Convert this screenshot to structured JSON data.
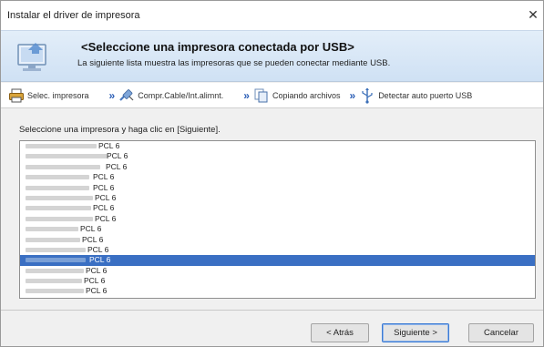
{
  "window": {
    "title": "Instalar el driver de impresora",
    "close_glyph": "✕"
  },
  "banner": {
    "heading": "<Seleccione una impresora conectada por USB>",
    "subheading": "La siguiente lista muestra las impresoras que se pueden conectar mediante USB.",
    "icon": "monitor-icon"
  },
  "steps": [
    {
      "label": "Selec. impresora",
      "icon": "printer-icon"
    },
    {
      "label": "Compr.Cable/Int.alimnt.",
      "icon": "cable-icon"
    },
    {
      "label": "Copiando archivos",
      "icon": "copy-files-icon"
    },
    {
      "label": "Detectar auto puerto USB",
      "icon": "usb-icon"
    }
  ],
  "step_separator": "»",
  "instruction": "Seleccione una impresora y haga clic en [Siguiente].",
  "printers": [
    {
      "name": "PCL 6",
      "selected": false
    },
    {
      "name": "PCL 6",
      "selected": false
    },
    {
      "name": "PCL 6",
      "selected": false
    },
    {
      "name": "PCL 6",
      "selected": false
    },
    {
      "name": "PCL 6",
      "selected": false
    },
    {
      "name": "PCL 6",
      "selected": false
    },
    {
      "name": "PCL 6",
      "selected": false
    },
    {
      "name": "PCL 6",
      "selected": false
    },
    {
      "name": "PCL 6",
      "selected": false
    },
    {
      "name": "PCL 6",
      "selected": false
    },
    {
      "name": "PCL 6",
      "selected": false
    },
    {
      "name": "PCL 6",
      "selected": true
    },
    {
      "name": "PCL 6",
      "selected": false
    },
    {
      "name": "PCL 6",
      "selected": false
    },
    {
      "name": "PCL 6",
      "selected": false
    }
  ],
  "buttons": {
    "back": "< Atrás",
    "next": "Siguiente >",
    "cancel": "Cancelar"
  },
  "colors": {
    "selection": "#3a6fc3",
    "accent": "#2a5db5",
    "banner": "#d8e7f6"
  }
}
